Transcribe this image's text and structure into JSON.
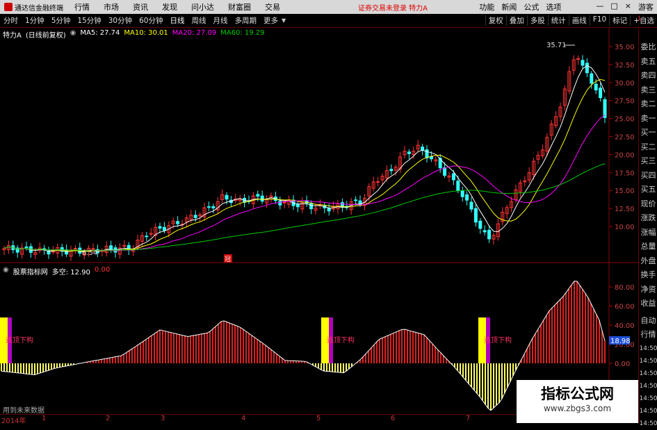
{
  "menubar": {
    "app_title": "通达信金融终端",
    "items": [
      "行情",
      "市场",
      "资讯",
      "发现",
      "问小达",
      "财富圈",
      "交易"
    ],
    "warning": "证券交易未登录  特力A",
    "right": [
      "功能",
      "新闻",
      "公式",
      "选项"
    ],
    "guest": "游客"
  },
  "tabs": [
    "分时",
    "1分钟",
    "5分钟",
    "15分钟",
    "30分钟",
    "60分钟",
    "日线",
    "周线",
    "月线",
    "多周期",
    "更多"
  ],
  "active_tab": "日线",
  "toolbar_right": [
    "复权",
    "叠加",
    "多股",
    "统计",
    "画线",
    "F10",
    "标记",
    "+自选"
  ],
  "legend": {
    "stock": "特力A",
    "mode": "(日线前复权)",
    "ma5": "MA5: 27.74",
    "ma10": "MA10: 30.01",
    "ma20": "MA20: 27.09",
    "ma60": "MA60: 19.29"
  },
  "colors": {
    "ma5": "#ffffff",
    "ma10": "#ffff00",
    "ma20": "#ff00ff",
    "ma60": "#00cc00",
    "up": "#ff3333",
    "down": "#33ffff"
  },
  "indicator_legend": {
    "name": "股票指标网",
    "label": "多空: 12.90",
    "value": "0.00"
  },
  "sidebar": [
    "委比",
    "卖五",
    "卖四",
    "卖三",
    "卖二",
    "卖一",
    "买一",
    "买二",
    "买三",
    "买四",
    "买五",
    "现价",
    "涨跌",
    "涨幅",
    "总量",
    "外盘",
    "换手",
    "净资",
    "收益"
  ],
  "sidebar_lower": [
    "自动",
    "行情",
    "14:50",
    "14:50",
    "14:50",
    "14:50",
    "14:50",
    "14:50",
    "14:50"
  ],
  "corner_label": "L",
  "price_axis": [
    "35.00",
    "32.50",
    "30.00",
    "27.50",
    "25.00",
    "22.50",
    "20.00",
    "17.50",
    "15.00",
    "12.50",
    "10.00"
  ],
  "price_high": "35.71",
  "price_low": "6.54",
  "indicator_axis": [
    "80.00",
    "60.00",
    "40.00",
    "20.00",
    "0.00"
  ],
  "indicator_current": "18.98",
  "signal_label": "逃顶下构",
  "no_data_text": "用到未来数据",
  "time_axis": [
    "2014年",
    "1",
    "2",
    "3",
    "4",
    "5",
    "6",
    "7"
  ],
  "marker_label": "冠",
  "watermark": {
    "title": "指标公式网",
    "url": "www.zbgs3.com"
  }
}
